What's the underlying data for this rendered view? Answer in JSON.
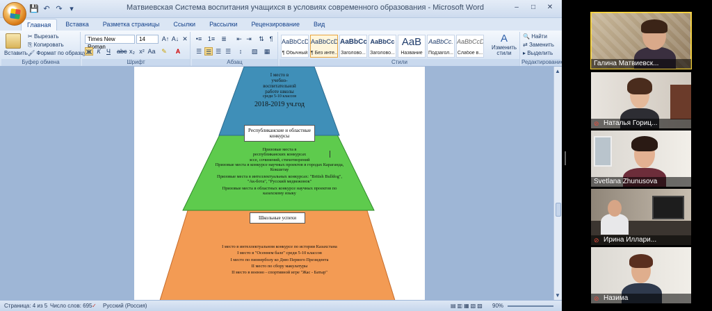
{
  "window": {
    "title": "Матвиевская Система воспитания учащихся в условиях современного образования - Microsoft Word"
  },
  "ribbon_tabs": [
    "Главная",
    "Вставка",
    "Разметка страницы",
    "Ссылки",
    "Рассылки",
    "Рецензирование",
    "Вид"
  ],
  "clipboard": {
    "paste": "Вставить",
    "cut": "Вырезать",
    "copy": "Копировать",
    "format_painter": "Формат по образцу",
    "label": "Буфер обмена"
  },
  "font": {
    "name": "Times New Roman",
    "size": "14",
    "label": "Шрифт",
    "bold": "Ж",
    "italic": "К",
    "underline": "Ч"
  },
  "paragraph": {
    "label": "Абзац"
  },
  "styles": {
    "label": "Стили",
    "items": [
      {
        "sample": "AaBbCcDc",
        "name": "¶ Обычный"
      },
      {
        "sample": "AaBbCcDc",
        "name": "¶ Без инте..."
      },
      {
        "sample": "AaBbCc",
        "name": "Заголово..."
      },
      {
        "sample": "AaBbCc",
        "name": "Заголово..."
      },
      {
        "sample": "AaB",
        "name": "Название"
      },
      {
        "sample": "AaBbCc.",
        "name": "Подзагол..."
      },
      {
        "sample": "AaBbCcDc",
        "name": "Слабое в..."
      }
    ],
    "change_styles": "Изменить стили"
  },
  "editing": {
    "label": "Редактирование",
    "find": "Найти",
    "replace": "Заменить",
    "select": "Выделить"
  },
  "document": {
    "top_tier": {
      "lines": [
        "I место в",
        "учебно-",
        "воспитательной",
        "работе школы",
        "среди 5-10 классов"
      ],
      "year": "2018-2019 уч.год"
    },
    "middle_tier": {
      "header": "Республиканские и областные конкурсы",
      "lines": [
        "Призовые места в",
        "республиканских конкурсах",
        "эссе, сочинений, стихотворений",
        "Призовые места в конкурсе научных проектов в городах Караганда, Кокшетау",
        "Призовые места в интеллектуальных конкурсах: \"British Bulldog\", \"Ак-бота\", \"Русский медвежонок\"",
        "Призовые места в областных конкурсе научных проектов по казахскому языку"
      ]
    },
    "bottom_tier": {
      "header": "Школьные успехи",
      "lines": [
        "I место в интеллектуальном конкурсе по истории Казахстана",
        "I место в \"Осеннем бале\" среди 5-10 классов",
        "I место по пионерболу ко Дню Первого Президента",
        "II место по сбору макулатуры",
        "II место в военно - спортивной игре \"Жас - Батыр\""
      ]
    }
  },
  "status": {
    "page": "Страница: 4 из 5",
    "words": "Число слов: 695",
    "language": "Русский (Россия)",
    "zoom": "90%"
  },
  "participants": [
    {
      "name": "Галина Матвиевск...",
      "muted": false,
      "active": true
    },
    {
      "name": "Наталья Гориц...",
      "muted": true,
      "active": false
    },
    {
      "name": "Svetlana Zhunusova",
      "muted": false,
      "active": false
    },
    {
      "name": "Ирина Иллари...",
      "muted": true,
      "active": false
    },
    {
      "name": "Назима",
      "muted": true,
      "active": false
    }
  ],
  "colors": {
    "tier_top": "#3f8fb8",
    "tier_middle": "#5ecb4d",
    "tier_bottom": "#f39b54",
    "active_speaker": "#f4d03f"
  }
}
